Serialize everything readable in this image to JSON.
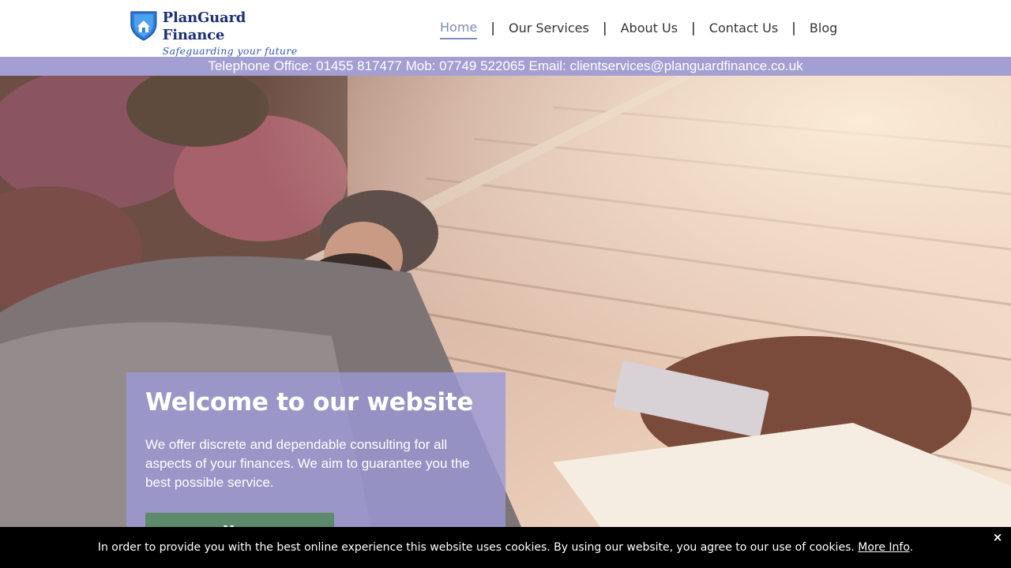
{
  "brand": {
    "name": "PlanGuard Finance",
    "tagline": "Safeguarding your future",
    "primary_color": "#1b2f7a",
    "shield_color": "#2f7fd8"
  },
  "nav": {
    "items": [
      {
        "label": "Home",
        "active": true
      },
      {
        "label": "Our Services",
        "active": false
      },
      {
        "label": "About Us",
        "active": false
      },
      {
        "label": "Contact Us",
        "active": false
      },
      {
        "label": "Blog",
        "active": false
      }
    ],
    "separator": "|",
    "active_color": "#7e8bc0"
  },
  "contact_bar": {
    "text": "Telephone Office: 01455 817477 Mob: 07749 522065 Email: clientservices@planguardfinance.co.uk",
    "background": "#a39fd3"
  },
  "hero": {
    "title": "Welcome to our website",
    "description": "We offer discrete and dependable consulting for all aspects of your finances. We aim to guarantee you the best possible service.",
    "button_label": "More",
    "button_color": "#5d8a6a",
    "box_color": "#9b98d4"
  },
  "cookie": {
    "message": "In order to provide you with the best online experience this website uses cookies. By using our website, you agree to our use of cookies. ",
    "link_label": "More Info",
    "suffix": ".",
    "close_label": "×"
  }
}
